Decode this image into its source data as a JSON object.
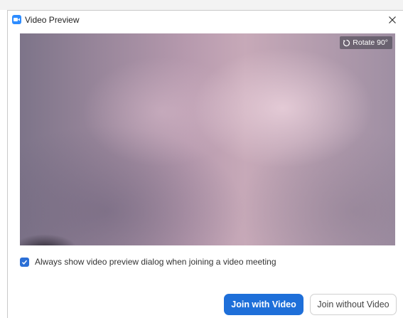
{
  "window": {
    "title": "Video Preview",
    "close_glyph": "×"
  },
  "video": {
    "rotate_label": "Rotate 90°"
  },
  "options": {
    "always_show_preview": {
      "label": "Always show video preview dialog when joining a video meeting",
      "checked": true
    }
  },
  "actions": {
    "join_with_video": "Join with Video",
    "join_without_video": "Join without Video"
  },
  "icons": {
    "app": "zoom-camera-icon",
    "close": "close-icon",
    "rotate": "rotate-icon",
    "check": "checkmark-icon"
  },
  "colors": {
    "accent": "#1e6fd9",
    "app_icon": "#2d8cff"
  }
}
